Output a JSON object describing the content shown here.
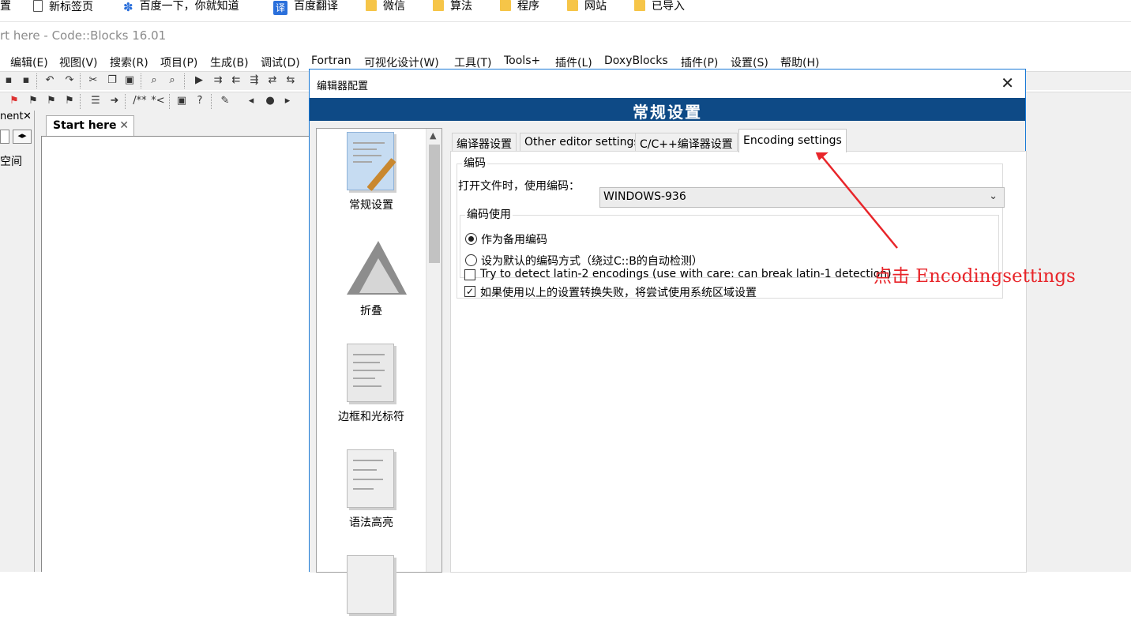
{
  "bookmarks": {
    "partial_first": "置",
    "items": [
      {
        "label": "新标签页",
        "icon": "page-icon"
      },
      {
        "label": "百度一下，你就知道",
        "icon": "baidu-paw-icon"
      },
      {
        "label": "百度翻译",
        "icon": "translate-icon",
        "icon_text": "译"
      },
      {
        "label": "微信",
        "icon": "folder-icon"
      },
      {
        "label": "算法",
        "icon": "folder-icon"
      },
      {
        "label": "程序",
        "icon": "folder-icon"
      },
      {
        "label": "网站",
        "icon": "folder-icon"
      },
      {
        "label": "已导入",
        "icon": "folder-icon"
      }
    ]
  },
  "window": {
    "title": "rt here - Code::Blocks 16.01"
  },
  "menu": [
    "编辑(E)",
    "视图(V)",
    "搜索(R)",
    "项目(P)",
    "生成(B)",
    "调试(D)",
    "Fortran",
    "可视化设计(W)",
    "工具(T)",
    "Tools+",
    "插件(L)",
    "DoxyBlocks",
    "插件(P)",
    "设置(S)",
    "帮助(H)"
  ],
  "toolbar2": {
    "comment1": "/**",
    "comment2": "*<"
  },
  "left_panel": {
    "tab_label": "nent",
    "close": "✕",
    "workspace_text": "空间"
  },
  "editor": {
    "tab_label": "Start here",
    "tab_close": "✕"
  },
  "dialog": {
    "title": "编辑器配置",
    "close": "✕",
    "banner": "常规设置",
    "categories": [
      {
        "label": "常规设置",
        "icon": "general-settings-icon"
      },
      {
        "label": "折叠",
        "icon": "folding-icon"
      },
      {
        "label": "边框和光标符",
        "icon": "margins-caret-icon"
      },
      {
        "label": "语法高亮",
        "icon": "syntax-highlight-icon"
      }
    ],
    "tabs": [
      "编译器设置",
      "Other editor settings",
      "C/C++编译器设置",
      "Encoding settings"
    ],
    "active_tab": "Encoding settings",
    "encoding_group": {
      "title": "编码",
      "open_label": "打开文件时，使用编码：",
      "encoding_value": "WINDOWS-936",
      "usage_group": {
        "title": "编码使用",
        "options": [
          {
            "label": "作为备用编码",
            "selected": true
          },
          {
            "label": "设为默认的编码方式（绕过C::B的自动检测）",
            "selected": false
          }
        ]
      },
      "checkboxes": [
        {
          "label": "Try to detect latin-2 encodings (use with care: can break latin-1 detection)",
          "checked": false
        },
        {
          "label": "如果使用以上的设置转换失败，将尝试使用系统区域设置",
          "checked": true
        }
      ]
    }
  },
  "annotation": {
    "text": "点击 Encodingsettings",
    "color": "#e8252a"
  }
}
